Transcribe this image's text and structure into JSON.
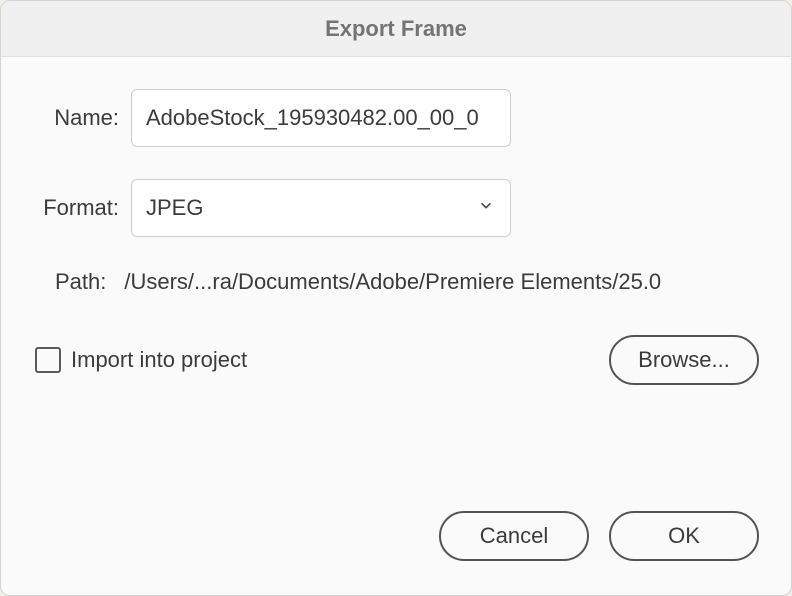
{
  "dialog": {
    "title": "Export Frame"
  },
  "form": {
    "name_label": "Name:",
    "name_value": "AdobeStock_195930482.00_00_0",
    "format_label": "Format:",
    "format_value": "JPEG",
    "path_label": "Path:",
    "path_value": "/Users/...ra/Documents/Adobe/Premiere Elements/25.0",
    "import_checkbox_label": "Import into project",
    "import_checkbox_checked": false
  },
  "buttons": {
    "browse": "Browse...",
    "cancel": "Cancel",
    "ok": "OK"
  }
}
